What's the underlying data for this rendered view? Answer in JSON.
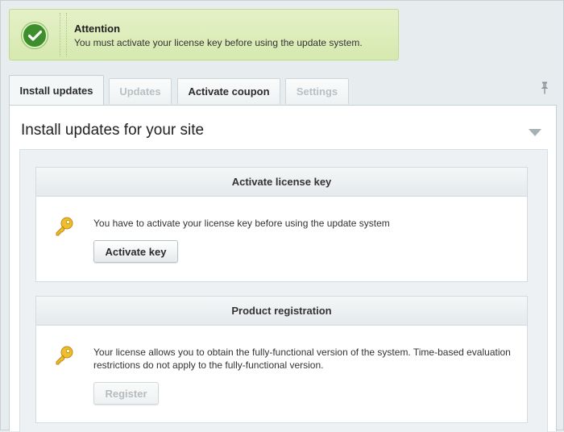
{
  "alert": {
    "title": "Attention",
    "message": "You must activate your license key before using the update system."
  },
  "tabs": [
    {
      "label": "Install updates",
      "state": "active"
    },
    {
      "label": "Updates",
      "state": "disabled"
    },
    {
      "label": "Activate coupon",
      "state": "enabled"
    },
    {
      "label": "Settings",
      "state": "disabled"
    }
  ],
  "panel": {
    "title": "Install updates for your site"
  },
  "cards": [
    {
      "header": "Activate license key",
      "text": "You have to activate your license key before using the update system",
      "button": "Activate key",
      "button_state": "enabled"
    },
    {
      "header": "Product registration",
      "text": "Your license allows you to obtain the fully-functional version of the system. Time-based evaluation restrictions do not apply to the fully-functional version.",
      "button": "Register",
      "button_state": "disabled"
    }
  ],
  "colors": {
    "alert_bg": "#d6e9af",
    "check_green": "#3d8f2d",
    "key_gold": "#e8b320",
    "page_bg": "#e7ecee"
  },
  "icons": [
    "check-circle-icon",
    "pin-icon",
    "collapse-arrow-icon",
    "key-icon"
  ]
}
